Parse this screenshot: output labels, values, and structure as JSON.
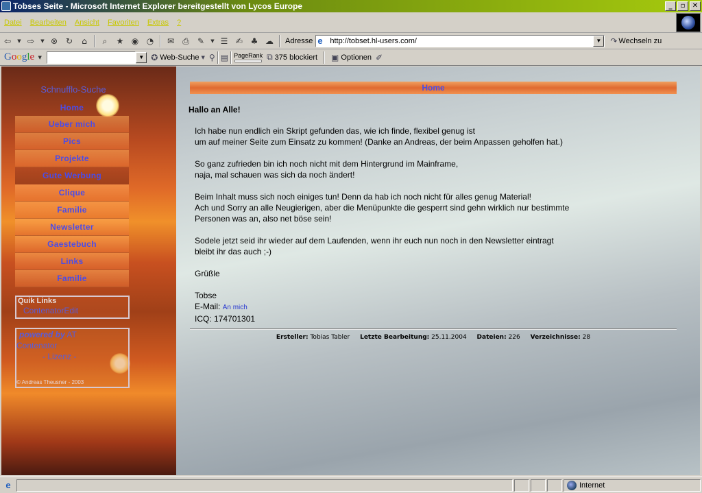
{
  "window": {
    "title": "Tobses Seite - Microsoft Internet Explorer bereitgestellt von Lycos Europe",
    "min_glyph": "_",
    "max_glyph": "▫",
    "close_glyph": "✕"
  },
  "menu": {
    "items": [
      "Datei",
      "Bearbeiten",
      "Ansicht",
      "Favoriten",
      "Extras",
      "?"
    ]
  },
  "toolbar": {
    "address_label": "Adresse",
    "url": "http://tobset.hl-users.com/",
    "go_label": "Wechseln zu"
  },
  "googlebar": {
    "web_search_label": "Web-Suche",
    "pagerank_label": "PageRank",
    "blocked_label": "375 blockiert",
    "options_label": "Optionen"
  },
  "sidebar": {
    "search_title": "Schnufflo-Suche",
    "nav_items": [
      "Home",
      "Ueber mich",
      "Pics",
      "Projekte",
      "Gute Werbung",
      "Clique",
      "Familie",
      "Newsletter",
      "Gaestebuch",
      "Links",
      "Familie"
    ],
    "quiklinks_title": "Quik Links",
    "quiklinks_link": "ContenatorEdit",
    "powered_by": "powered by",
    "powered_at": "AT",
    "powered_name": "Contenator",
    "license": "- Lizenz -",
    "copyright": "© Andreas Theusner - 2003"
  },
  "main": {
    "header_link": "Home",
    "greeting": "Hallo an Alle!",
    "paragraphs": [
      [
        "Ich habe nun endlich ein Skript gefunden das, wie ich finde, flexibel genug ist",
        "um auf meiner Seite zum Einsatz zu kommen! (Danke an Andreas, der beim Anpassen geholfen hat.)"
      ],
      [
        "So ganz zufrieden bin ich noch nicht mit dem Hintergrund im Mainframe,",
        "naja, mal schauen was sich da noch ändert!"
      ],
      [
        "Beim Inhalt muss sich noch einiges tun! Denn da hab ich noch nicht für alles genug Material!",
        "Ach und Sorry an alle Neugierigen, aber die Menüpunkte die gesperrt sind gehn wirklich nur bestimmte",
        "Personen was an, also net böse sein!"
      ],
      [
        "Sodele jetzt seid ihr wieder auf dem Laufenden, wenn ihr euch nun noch in den Newsletter eintragt",
        "bleibt ihr das auch ;-)"
      ]
    ],
    "greeting_end": "Grüßle",
    "signature": "Tobse",
    "email_label": "E-Mail:",
    "email_link": "An mich",
    "icq": "ICQ: 174701301"
  },
  "footer": {
    "creator_label": "Ersteller:",
    "creator": "Tobias Tabler",
    "last_edit_label": "Letzte Bearbeitung:",
    "last_edit": "25.11.2004",
    "files_label": "Dateien:",
    "files": "226",
    "dirs_label": "Verzeichnisse:",
    "dirs": "28"
  },
  "status": {
    "zone": "Internet"
  },
  "icons": [
    "ie-icon",
    "back-icon",
    "forward-icon",
    "stop-icon",
    "refresh-icon",
    "home-icon",
    "search-icon",
    "favorites-icon",
    "history-icon",
    "mail-icon",
    "print-icon",
    "edit-icon",
    "discuss-icon",
    "messenger-icon",
    "globe-icon"
  ]
}
